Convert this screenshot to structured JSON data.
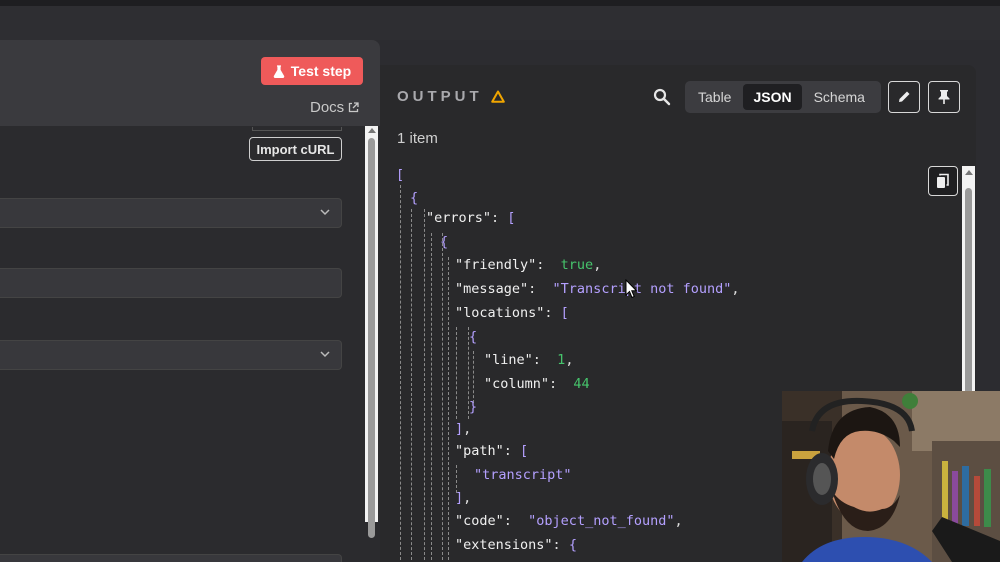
{
  "left_panel": {
    "test_step_label": "Test step",
    "docs_label": "Docs",
    "import_curl_label": "Import cURL"
  },
  "output": {
    "title": "OUTPUT",
    "tabs": [
      {
        "label": "Table"
      },
      {
        "label": "JSON"
      },
      {
        "label": "Schema"
      }
    ],
    "active_tab": "JSON",
    "item_count": "1 item",
    "json_lines": [
      {
        "key": "open_bracket",
        "text": "["
      },
      {
        "key": "open_brace",
        "text": "{"
      },
      {
        "key": "errors_key",
        "text": "\"errors\""
      },
      {
        "key": "friendly_key",
        "text": "\"friendly\""
      },
      {
        "key": "friendly_val",
        "text": "true"
      },
      {
        "key": "message_key",
        "text": "\"message\""
      },
      {
        "key": "message_val",
        "text": "\"Transcript not found\""
      },
      {
        "key": "locations_key",
        "text": "\"locations\""
      },
      {
        "key": "line_key",
        "text": "\"line\""
      },
      {
        "key": "line_val",
        "text": "1"
      },
      {
        "key": "column_key",
        "text": "\"column\""
      },
      {
        "key": "column_val",
        "text": "44"
      },
      {
        "key": "path_key",
        "text": "\"path\""
      },
      {
        "key": "path_val",
        "text": "\"transcript\""
      },
      {
        "key": "code_key",
        "text": "\"code\""
      },
      {
        "key": "code_val",
        "text": "\"object_not_found\""
      },
      {
        "key": "extensions_key",
        "text": "\"extensions\""
      }
    ]
  },
  "colors": {
    "test_step_bg": "#ef5a5a",
    "json_string": "#b4a0ff",
    "json_literal": "#46c46c",
    "warning": "#f0a500"
  },
  "icons": [
    "flask-icon",
    "external-link-icon",
    "chevron-down-icon",
    "warning-icon",
    "search-icon",
    "pencil-icon",
    "pin-icon",
    "copy-icon"
  ]
}
